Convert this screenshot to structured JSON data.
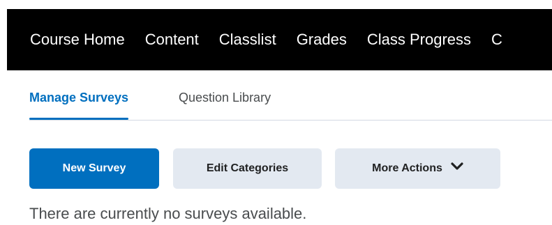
{
  "nav": {
    "items": [
      {
        "label": "Course Home"
      },
      {
        "label": "Content"
      },
      {
        "label": "Classlist"
      },
      {
        "label": "Grades"
      },
      {
        "label": "Class Progress"
      },
      {
        "label": "C"
      }
    ]
  },
  "tabs": [
    {
      "label": "Manage Surveys",
      "active": true
    },
    {
      "label": "Question Library",
      "active": false
    }
  ],
  "actions": {
    "new_survey": "New Survey",
    "edit_categories": "Edit Categories",
    "more_actions": "More Actions",
    "more_actions_icon": "chevron-down-icon"
  },
  "empty_message": "There are currently no surveys available.",
  "colors": {
    "nav_bg": "#000000",
    "accent": "#006fbf",
    "secondary_button_bg": "#e3e9f1",
    "body_text": "#494c4e"
  }
}
